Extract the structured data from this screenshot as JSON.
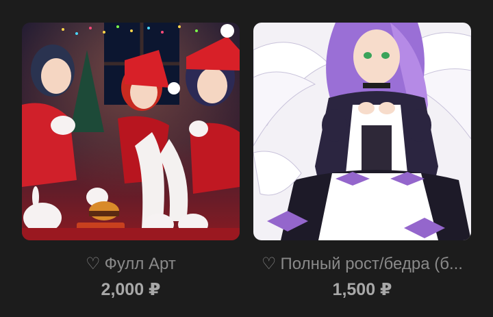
{
  "products": [
    {
      "icon": "heart-outline-icon",
      "heart": "♡",
      "title": "Фулл Арт",
      "price": "2,000 ₽",
      "image": "christmas-girls-artwork"
    },
    {
      "icon": "heart-outline-icon",
      "heart": "♡",
      "title": "Полный рост/бедра (б...",
      "price": "1,500 ₽",
      "image": "maid-angel-girl-artwork"
    }
  ],
  "colors": {
    "background": "#1c1c1c",
    "title_text": "#8a8a8a",
    "price_text": "#a8a8a8"
  }
}
